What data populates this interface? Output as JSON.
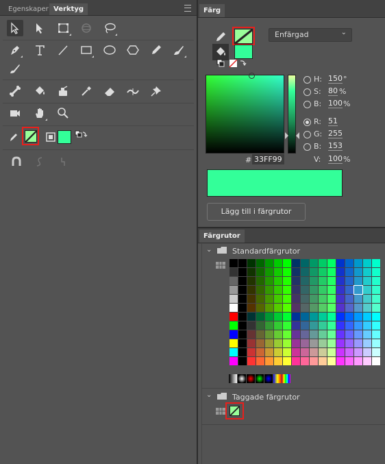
{
  "left_panel": {
    "tabs": [
      {
        "label": "Egenskaper"
      },
      {
        "label": "Verktyg"
      }
    ],
    "tools": [
      {
        "name": "selection-tool"
      },
      {
        "name": "subselection-tool"
      },
      {
        "name": "free-transform-tool"
      },
      {
        "name": "3d-rotation-tool"
      },
      {
        "name": "lasso-tool"
      },
      {
        "name": "pen-tool"
      },
      {
        "name": "text-tool"
      },
      {
        "name": "line-tool"
      },
      {
        "name": "rectangle-tool"
      },
      {
        "name": "oval-tool"
      },
      {
        "name": "polystar-tool"
      },
      {
        "name": "pencil-tool"
      },
      {
        "name": "paint-brush-tool"
      },
      {
        "name": "brush-tool"
      },
      {
        "name": "bone-tool"
      },
      {
        "name": "paint-bucket-tool"
      },
      {
        "name": "ink-bottle-tool"
      },
      {
        "name": "eyedropper-tool"
      },
      {
        "name": "eraser-tool"
      },
      {
        "name": "width-tool"
      },
      {
        "name": "pin-tool"
      },
      {
        "name": "camera-tool"
      },
      {
        "name": "hand-tool"
      },
      {
        "name": "zoom-tool"
      }
    ],
    "colors": {
      "stroke": "#99FF99",
      "fill": "#33FF99"
    },
    "options": [
      {
        "name": "snap-icon"
      },
      {
        "name": "smooth-icon"
      },
      {
        "name": "straighten-icon"
      }
    ]
  },
  "right_panel": {
    "color_tab": {
      "label": "Färg"
    },
    "fill_type": "Enfärgad",
    "stroke_color": "#99FF99",
    "fill_color": "#33FF99",
    "hsb": [
      {
        "key": "H:",
        "value": "150",
        "unit": "°",
        "selected": false
      },
      {
        "key": "S:",
        "value": "80",
        "unit": "%",
        "selected": false
      },
      {
        "key": "B:",
        "value": "100",
        "unit": "%",
        "selected": false
      }
    ],
    "rgb": [
      {
        "key": "R:",
        "value": "51",
        "unit": "",
        "selected": true
      },
      {
        "key": "G:",
        "value": "255",
        "unit": "",
        "selected": false
      },
      {
        "key": "B:",
        "value": "153",
        "unit": "",
        "selected": false
      }
    ],
    "hex_label": "#",
    "hex_value": "33FF99",
    "alpha": {
      "key": "V:",
      "value": "100",
      "unit": "%"
    },
    "preview_color": "#33FF99",
    "add_button": "Lägg till i färgrutor",
    "swatches_tab": {
      "label": "Färgrutor"
    },
    "groups": [
      {
        "label": "Standardfärgrutor"
      },
      {
        "label": "Taggade färgrutor"
      }
    ],
    "tagged_swatch": "#99FF99"
  }
}
